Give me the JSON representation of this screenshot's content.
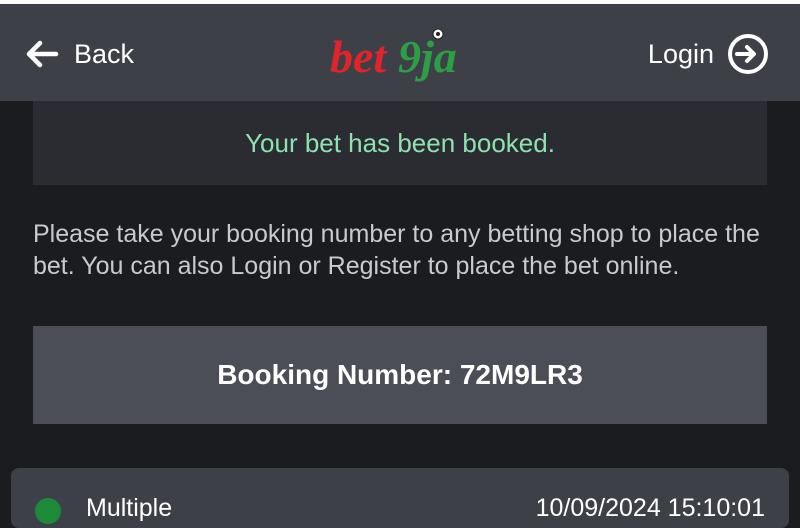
{
  "header": {
    "back_label": "Back",
    "logo_text": "bet9ja",
    "login_label": "Login"
  },
  "message": {
    "success": "Your bet has been booked.",
    "info": "Please take your booking number to any betting shop to place the bet. You can also Login or Register to place the bet online."
  },
  "booking": {
    "label": "Booking Number: 72M9LR3"
  },
  "bet_card": {
    "type": "Multiple",
    "timestamp": "10/09/2024 15:10:01"
  },
  "colors": {
    "header_bg": "#3e4048",
    "page_bg": "#1b1c20",
    "success_text": "#8fe2b0",
    "logo_red": "#e2232a",
    "logo_green": "#2e9e45"
  },
  "icons": {
    "back": "arrow-left-icon",
    "login": "login-arrow-circle-icon"
  }
}
